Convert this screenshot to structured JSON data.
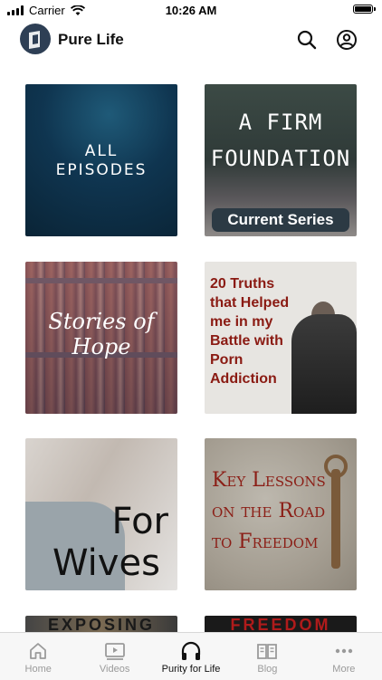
{
  "status": {
    "carrier": "Carrier",
    "time": "10:26 AM",
    "battery_level": 0.9
  },
  "header": {
    "title": "Pure Life"
  },
  "tiles": [
    {
      "line1": "ALL",
      "line2": "EPISODES"
    },
    {
      "line1": "A FIRM",
      "line2": "FOUNDATION",
      "badge": "Current Series"
    },
    {
      "text": "Stories of Hope"
    },
    {
      "lines": [
        "20 Truths",
        "that Helped",
        "me in my",
        "Battle with",
        "Porn",
        "Addiction"
      ]
    },
    {
      "line1": "For",
      "line2": "Wives"
    },
    {
      "lines": [
        "Key Lessons",
        "on the Road",
        "to Freedom"
      ]
    },
    {
      "text": "EXPOSING"
    },
    {
      "text": "FREEDOM"
    }
  ],
  "tabs": [
    {
      "label": "Home",
      "icon": "home-icon"
    },
    {
      "label": "Videos",
      "icon": "video-icon"
    },
    {
      "label": "Purity for Life",
      "icon": "headphones-icon"
    },
    {
      "label": "Blog",
      "icon": "book-icon"
    },
    {
      "label": "More",
      "icon": "more-icon"
    }
  ],
  "colors": {
    "active_tab": "#111111",
    "inactive_tab": "#9a9a9a",
    "accent_red": "#8a1a12"
  }
}
